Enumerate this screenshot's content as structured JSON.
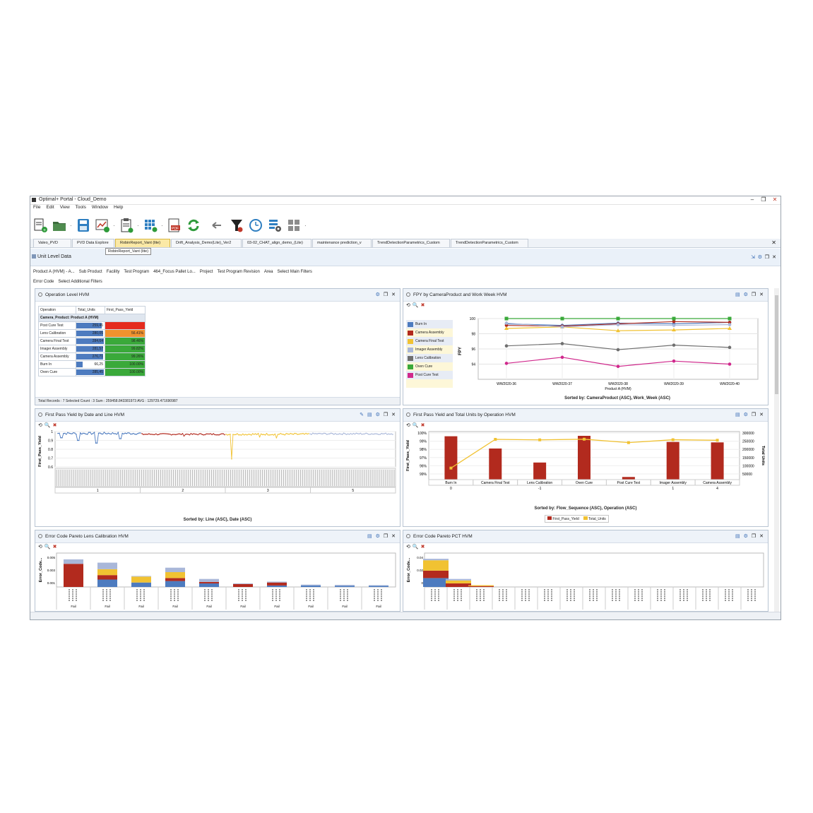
{
  "window": {
    "title": "Optimal+ Portal - Cloud_Demo"
  },
  "menu": [
    "File",
    "Edit",
    "View",
    "Tools",
    "Window",
    "Help"
  ],
  "tabs": [
    {
      "label": "Valeo_PVD"
    },
    {
      "label": "PVD Data Explore"
    },
    {
      "label": "RobinReport_Vant (lite)"
    },
    {
      "label": "Drift_Analysis_Demo(Lite)_Ver2"
    },
    {
      "label": "03-02_CHAT_align_demo_(Lite)"
    },
    {
      "label": "maintenance prediction_v"
    },
    {
      "label": "TrendDetectionParametrics_Custom"
    },
    {
      "label": "TrendDetectionParametrics_Custom"
    }
  ],
  "tooltip": "RobinReport_Vant (lite)",
  "view": {
    "title": "Unit Level Data"
  },
  "filters": {
    "row1": [
      "Product A (HVM) - A...",
      "Sub Product",
      "Facility",
      "Test Program",
      "464_Focus Pallet Lo...",
      "Project",
      "Test Program Revision",
      "Area",
      "Select Main Filters"
    ],
    "row2": [
      "Error Code",
      "Select Additional Filters"
    ]
  },
  "colors": {
    "red": "#b22a1e",
    "yellow": "#f1c232",
    "blue": "#4d7bbf",
    "green": "#3aa93a",
    "gray": "#6f6f6f",
    "magenta": "#d0288c",
    "lavender": "#a9b7d9",
    "orange": "#f0922e"
  },
  "panels": {
    "op_level": {
      "title": "Operation Level HVM",
      "columns": [
        "Operation",
        "Total_Units",
        "First_Pass_Yield"
      ],
      "group": "Camera_Product: Product A (HVM)",
      "rows": [
        {
          "op": "Post Cure Test",
          "units": "259,46",
          "fpy": "",
          "units_frac": 0.9,
          "fpy_color": "#e52b1e"
        },
        {
          "op": "Lens Calibration",
          "units": "280,05",
          "fpy": "56.41%",
          "units_frac": 0.95,
          "fpy_color": "#f0922e"
        },
        {
          "op": "Camera Final Test",
          "units": "284,64",
          "fpy": "98.46%",
          "units_frac": 0.97,
          "fpy_color": "#3aa93a"
        },
        {
          "op": "Imager Assembly",
          "units": "281,57",
          "fpy": "99.82%",
          "units_frac": 0.96,
          "fpy_color": "#3aa93a"
        },
        {
          "op": "Camera Assembly",
          "units": "276,71",
          "fpy": "99.26%",
          "units_frac": 0.94,
          "fpy_color": "#3aa93a"
        },
        {
          "op": "Burn In",
          "units": "66,25",
          "fpy": "100.00%",
          "units_frac": 0.22,
          "fpy_color": "#3aa93a"
        },
        {
          "op": "Oven Cure",
          "units": "285,45",
          "fpy": "100.00%",
          "units_frac": 0.98,
          "fpy_color": "#3aa93a"
        }
      ],
      "footer": "Total Records : 7  Selected Count : 3  Sum : 259458.843381973  AVG : 129729.471690987"
    },
    "fpy_week": {
      "title": "FPY by CameraProduct and Work Week HVM",
      "legend": [
        {
          "name": "Burn In",
          "color": "#4d7bbf"
        },
        {
          "name": "Camera Assembly",
          "color": "#b22a1e"
        },
        {
          "name": "Camera Final Test",
          "color": "#f1c232"
        },
        {
          "name": "Imager Assembly",
          "color": "#a9b7d9"
        },
        {
          "name": "Lens Calibration",
          "color": "#6f6f6f"
        },
        {
          "name": "Oven Cure",
          "color": "#3aa93a"
        },
        {
          "name": "Post Cure Test",
          "color": "#d0288c"
        }
      ],
      "sorted": "Sorted by: CameraProduct (ASC), Work_Week (ASC)"
    },
    "fpy_date": {
      "title": "First Pass Yield by Date and Line HVM",
      "sorted": "Sorted by: Line (ASC), Date (ASC)"
    },
    "fpy_op": {
      "title": "First Pass Yield and Total Units by Operation HVM",
      "sorted": "Sorted by: Flow_Sequence (ASC), Operation (ASC)",
      "legend": [
        "First_Pass_Yield",
        "Total_Units"
      ]
    },
    "pareto_lens": {
      "title": "Error Code Pareto Lens Calibration HVM"
    },
    "pareto_pct": {
      "title": "Error Code Pareto PCT HVM"
    }
  },
  "chart_data": [
    {
      "type": "line",
      "title": "",
      "xlabel": "Product A (HVM)",
      "ylabel": "FPY",
      "categories": [
        "WW2020-36",
        "WW2020-37",
        "WW2020-38",
        "WW2020-39",
        "WW2020-40"
      ],
      "ylim": [
        92,
        100
      ],
      "yticks": [
        94,
        96,
        98,
        100
      ],
      "series": [
        {
          "name": "Burn In",
          "color": "#4d7bbf",
          "values": [
            99.3,
            99.1,
            99.4,
            99.3,
            99.5
          ]
        },
        {
          "name": "Camera Assembly",
          "color": "#b22a1e",
          "values": [
            99.1,
            99.0,
            99.3,
            99.6,
            99.5
          ]
        },
        {
          "name": "Camera Final Test",
          "color": "#f1c232",
          "values": [
            98.7,
            98.9,
            98.4,
            98.5,
            98.7
          ]
        },
        {
          "name": "Imager Assembly",
          "color": "#a9b7d9",
          "values": [
            99.4,
            98.9,
            99.2,
            99.1,
            99.2
          ]
        },
        {
          "name": "Lens Calibration",
          "color": "#6f6f6f",
          "values": [
            96.4,
            96.7,
            95.9,
            96.5,
            96.2
          ]
        },
        {
          "name": "Oven Cure",
          "color": "#3aa93a",
          "values": [
            100.0,
            100.0,
            100.0,
            100.0,
            100.0
          ]
        },
        {
          "name": "Post Cure Test",
          "color": "#d0288c",
          "values": [
            94.1,
            94.9,
            93.7,
            94.4,
            94.0
          ]
        }
      ]
    },
    {
      "type": "line",
      "title": "",
      "ylabel": "First_Pass_Yield",
      "xlabel": "",
      "yticks": [
        0.6,
        0.7,
        0.8,
        0.9,
        1
      ],
      "ylim": [
        0.6,
        1.0
      ],
      "line_groups": [
        "1",
        "2",
        "3",
        "5"
      ],
      "segments": [
        {
          "color": "#4d7bbf",
          "start": 0.98,
          "noise": 0.012,
          "dips": [
            [
              0.04,
              0.93
            ],
            [
              0.24,
              0.9
            ],
            [
              0.46,
              0.87
            ],
            [
              0.74,
              0.92
            ]
          ]
        },
        {
          "color": "#b22a1e",
          "start": 0.97,
          "noise": 0.008,
          "dips": [
            [
              0.5,
              0.95
            ]
          ]
        },
        {
          "color": "#f1c232",
          "start": 0.97,
          "noise": 0.01,
          "dips": [
            [
              0.07,
              0.69
            ],
            [
              0.4,
              0.94
            ],
            [
              0.6,
              0.93
            ]
          ]
        },
        {
          "color": "#a9b7d9",
          "start": 0.975,
          "noise": 0.008,
          "dips": []
        }
      ]
    },
    {
      "type": "bar",
      "title": "",
      "ylabel": "First_Pass_Yield",
      "y2label": "Total Units",
      "categories": [
        "Burn In",
        "Camera Final Test",
        "Lens Calibration",
        "Oven Cure",
        "Post Cure Test",
        "Imager Assembly",
        "Camera Assembly"
      ],
      "flow_sequence": [
        "0",
        "",
        "-1",
        "",
        "",
        "1",
        "4"
      ],
      "yticks": [
        "99%",
        "96%",
        "97%",
        "98%",
        "99%",
        "100%"
      ],
      "y2ticks": [
        "50000",
        "100000",
        "150000",
        "200000",
        "250000",
        "300000"
      ],
      "series": [
        {
          "name": "First_Pass_Yield",
          "color": "#b22a1e",
          "values": [
            0.99,
            0.71,
            0.39,
            1.0,
            0.06,
            0.86,
            0.85
          ]
        },
        {
          "name": "Total_Units",
          "color": "#f1c232",
          "values": [
            66000,
            284000,
            280000,
            285000,
            259000,
            281000,
            277000
          ]
        }
      ]
    },
    {
      "type": "bar",
      "title": "",
      "ylabel": "Error_Code...",
      "yticks": [
        0.001,
        0.003,
        0.005
      ],
      "categories": [
        "Fail",
        "Fail",
        "Fail",
        "Fail",
        "Fail",
        "Fail",
        "Fail",
        "Fail",
        "Fail",
        "Fail"
      ],
      "stacks": [
        [
          [
            "#b22a1e",
            0.78
          ],
          [
            "#a9b7d9",
            0.15
          ]
        ],
        [
          [
            "#4d7bbf",
            0.25
          ],
          [
            "#b22a1e",
            0.15
          ],
          [
            "#f1c232",
            0.2
          ],
          [
            "#a9b7d9",
            0.22
          ]
        ],
        [
          [
            "#4d7bbf",
            0.15
          ],
          [
            "#f1c232",
            0.2
          ],
          [
            "#a9b7d9",
            0.02
          ]
        ],
        [
          [
            "#4d7bbf",
            0.2
          ],
          [
            "#b22a1e",
            0.1
          ],
          [
            "#f1c232",
            0.2
          ],
          [
            "#a9b7d9",
            0.15
          ]
        ],
        [
          [
            "#4d7bbf",
            0.12
          ],
          [
            "#b22a1e",
            0.05
          ],
          [
            "#a9b7d9",
            0.1
          ]
        ],
        [
          [
            "#b22a1e",
            0.1
          ],
          [
            "#a9b7d9",
            0.02
          ]
        ],
        [
          [
            "#4d7bbf",
            0.05
          ],
          [
            "#b22a1e",
            0.1
          ],
          [
            "#a9b7d9",
            0.03
          ]
        ],
        [
          [
            "#4d7bbf",
            0.05
          ],
          [
            "#a9b7d9",
            0.03
          ]
        ],
        [
          [
            "#4d7bbf",
            0.04
          ],
          [
            "#a9b7d9",
            0.03
          ]
        ],
        [
          [
            "#4d7bbf",
            0.04
          ],
          [
            "#a9b7d9",
            0.02
          ]
        ]
      ]
    },
    {
      "type": "bar",
      "title": "",
      "ylabel": "Error_Code...",
      "yticks": [
        0,
        0.02,
        0.04
      ],
      "stacks": [
        [
          [
            "#4d7bbf",
            0.3
          ],
          [
            "#b22a1e",
            0.25
          ],
          [
            "#f1c232",
            0.35
          ],
          [
            "#a9b7d9",
            0.05
          ]
        ],
        [
          [
            "#b22a1e",
            0.12
          ],
          [
            "#f1c232",
            0.1
          ],
          [
            "#a9b7d9",
            0.05
          ]
        ],
        [
          [
            "#b22a1e",
            0.03
          ],
          [
            "#f1c232",
            0.03
          ]
        ],
        [],
        [],
        [],
        [],
        [],
        [],
        [],
        [],
        [],
        [],
        [],
        []
      ]
    }
  ]
}
